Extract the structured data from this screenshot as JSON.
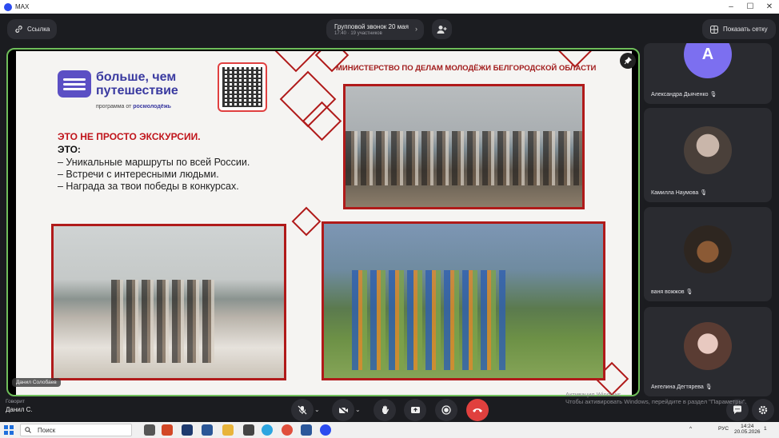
{
  "window": {
    "app_title": "MAX",
    "controls": [
      "–",
      "☐",
      "✕"
    ]
  },
  "topbar": {
    "link_label": "Ссылка",
    "call_title": "Групповой звонок 20 мая",
    "call_meta": "17:40 · 19 участников",
    "grid_label": "Показать сетку"
  },
  "slide": {
    "brand_line1": "больше, чем",
    "brand_line2": "путешествие",
    "brand_sub_prefix": "программа от",
    "brand_sub_org": "росмолодёжь",
    "ministry": "МИНИСТЕРСТВО ПО ДЕЛАМ МОЛОДЁЖИ БЕЛГОРОДСКОЙ ОБЛАСТИ",
    "headline": "ЭТО НЕ ПРОСТО ЭКСКУРСИИ.",
    "subhead": "ЭТО:",
    "bullets": [
      "– Уникальные маршруты по всей России.",
      "– Встречи с интересными людьми.",
      "– Награда за твои победы в конкурсах."
    ]
  },
  "stage": {
    "speaker_tag": "Данил Солобаев"
  },
  "participants": [
    {
      "name": "Александра Дьяченко",
      "initial": "А",
      "avatar_color": "#7c6ff0"
    },
    {
      "name": "Камилла Наумова",
      "initial": "",
      "avatar_color": "#8a7f78"
    },
    {
      "name": "ваня вожжов",
      "initial": "",
      "avatar_color": "#5c4a3a"
    },
    {
      "name": "Ангелина Дегтярева",
      "initial": "",
      "avatar_color": "#b88c86"
    }
  ],
  "bottom": {
    "speaking_label": "Говорит",
    "speaking_name": "Данил С."
  },
  "watermark": {
    "line1": "Активация Windows",
    "line2": "Чтобы активировать Windows, перейдите в раздел \"Параметры\"."
  },
  "taskbar": {
    "search_placeholder": "Поиск",
    "lang": "РУС",
    "time": "14:24",
    "date": "20.05.2026",
    "notif_count": "1"
  },
  "colors": {
    "accent_border": "#6fbe5a",
    "end_call": "#e0403e",
    "slide_red": "#b01a1a"
  }
}
